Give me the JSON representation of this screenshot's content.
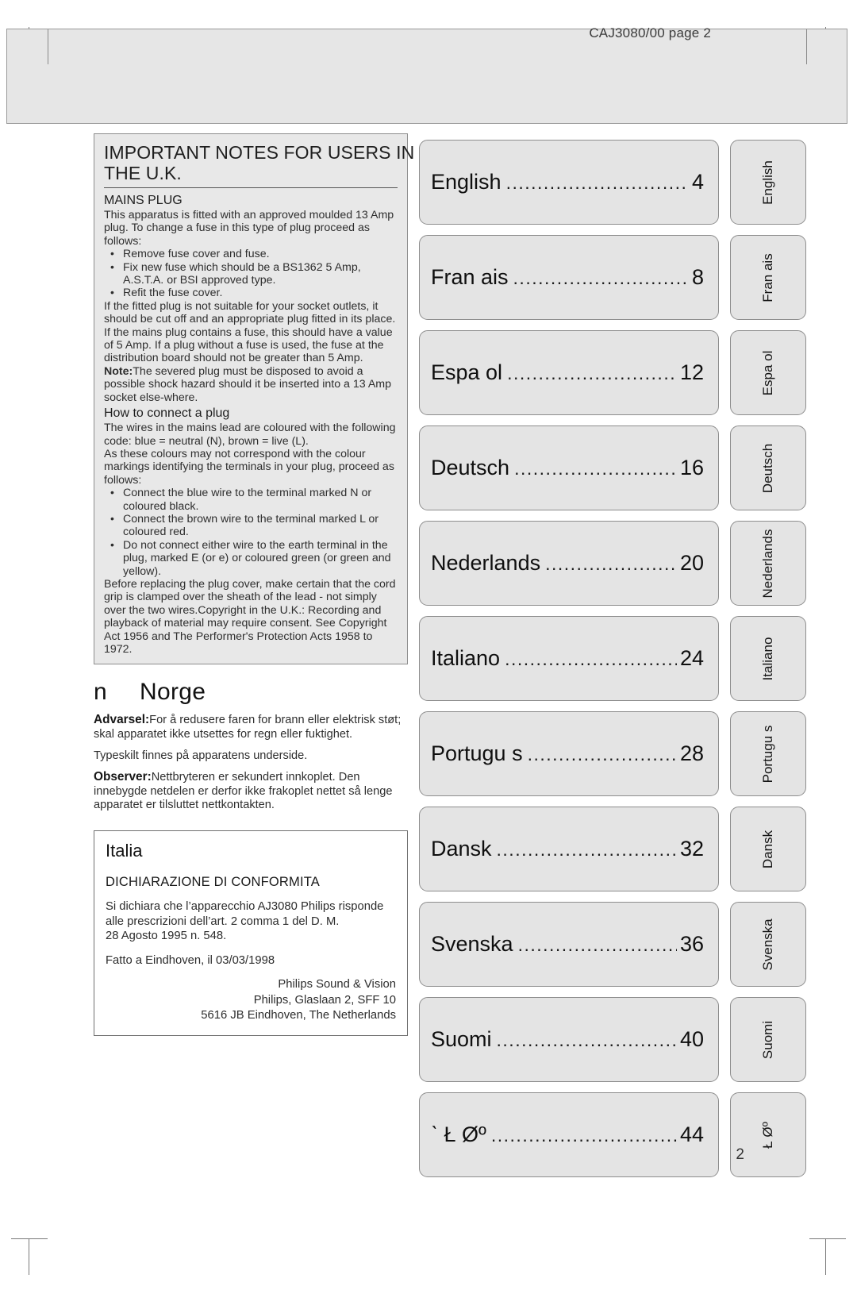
{
  "header": {
    "code": "CAJ3080/00 page 2"
  },
  "uk_notes": {
    "title_line1": "IMPORTANT NOTES FOR USERS IN",
    "title_line2": "THE U.K.",
    "section_heading": "MAINS PLUG",
    "intro": "This apparatus is fitted with an approved moulded 13 Amp plug. To change a fuse in this type of plug proceed as follows:",
    "fuse_steps": [
      "Remove fuse cover and fuse.",
      "Fix new fuse which should be a BS1362 5 Amp, A.S.T.A. or BSI approved type.",
      "Refit the fuse cover."
    ],
    "para_unsuitable": "If the fitted plug is not suitable for your socket outlets, it should be cut off and an appropriate plug fitted in its place.",
    "para_fuse_value": "If the mains plug contains a fuse, this should have a value of 5 Amp. If a plug without a fuse is used, the fuse at the distribution board should not be greater than 5 Amp.",
    "note_label": "Note:",
    "note_text": "The severed plug must be disposed to avoid a possible shock hazard should it be inserted into a 13 Amp socket else-where.",
    "connect_heading": "How to connect a plug",
    "wire_code": "The wires in the mains lead are coloured with the following code: blue = neutral (N), brown = live (L).",
    "colour_markings": "As these colours may not correspond with the colour markings identifying the terminals in your plug, proceed as follows:",
    "wire_steps": [
      "Connect the blue wire to the terminal marked N or coloured black.",
      "Connect the brown wire to the terminal marked L or coloured red.",
      "Do not connect either wire to the earth terminal in the plug, marked E (or e) or coloured green (or green and yellow)."
    ],
    "closing": "Before replacing the plug cover, make certain that the cord grip is clamped over the sheath of the lead - not simply over the two wires.Copyright in the U.K.: Recording and playback of material may require consent. See Copyright Act 1956 and The Performer's Protection Acts 1958 to 1972."
  },
  "norge": {
    "flag_glyph": "n",
    "heading": "Norge",
    "advarsel_label": "Advarsel:",
    "advarsel_text": "For å redusere faren for brann eller elektrisk støt; skal apparatet ikke utsettes for regn eller fuktighet.",
    "typeskilt": "Typeskilt finnes på apparatens underside.",
    "observer_label": "Observer:",
    "observer_text": "Nettbryteren er sekundert innkoplet. Den innebygde netdelen er derfor ikke frakoplet nettet så lenge apparatet er tilsluttet nettkontakten."
  },
  "italia": {
    "title": "Italia",
    "subtitle": "DICHIARAZIONE DI CONFORMITA",
    "body_line1": "Si dichiara che l’apparecchio AJ3080 Philips risponde",
    "body_line2": "alle prescrizioni dell’art. 2 comma 1 del D. M.",
    "body_line3": "28 Agosto 1995 n. 548.",
    "place_date": "Fatto a Eindhoven, il 03/03/1998",
    "address_line1": "Philips Sound & Vision",
    "address_line2": "Philips, Glaslaan 2, SFF 10",
    "address_line3": "5616 JB Eindhoven, The Netherlands"
  },
  "contents": {
    "leader": "........................................................",
    "items": [
      {
        "language": "English",
        "page": "4",
        "tab": "English"
      },
      {
        "language": "Fran ais",
        "page": "8",
        "tab": "Fran ais"
      },
      {
        "language": "Espa ol",
        "page": "12",
        "tab": "Espa ol"
      },
      {
        "language": "Deutsch",
        "page": "16",
        "tab": "Deutsch"
      },
      {
        "language": "Nederlands",
        "page": "20",
        "tab": "Nederlands"
      },
      {
        "language": "Italiano",
        "page": "24",
        "tab": "Italiano"
      },
      {
        "language": "Portugu s",
        "page": "28",
        "tab": "Portugu s"
      },
      {
        "language": "Dansk",
        "page": "32",
        "tab": "Dansk"
      },
      {
        "language": "Svenska",
        "page": "36",
        "tab": "Svenska"
      },
      {
        "language": "Suomi",
        "page": "40",
        "tab": "Suomi"
      },
      {
        "language": "ˋ Ł Øº",
        "page": "44",
        "tab": "Ł Øº"
      }
    ]
  },
  "footer": {
    "page_number": "2"
  },
  "colors": {
    "panel_fill": "#e4e4e4",
    "header_fill": "#e6e6e6",
    "uk_box_fill": "#e8e8e8",
    "border": "#8d8d8d"
  }
}
